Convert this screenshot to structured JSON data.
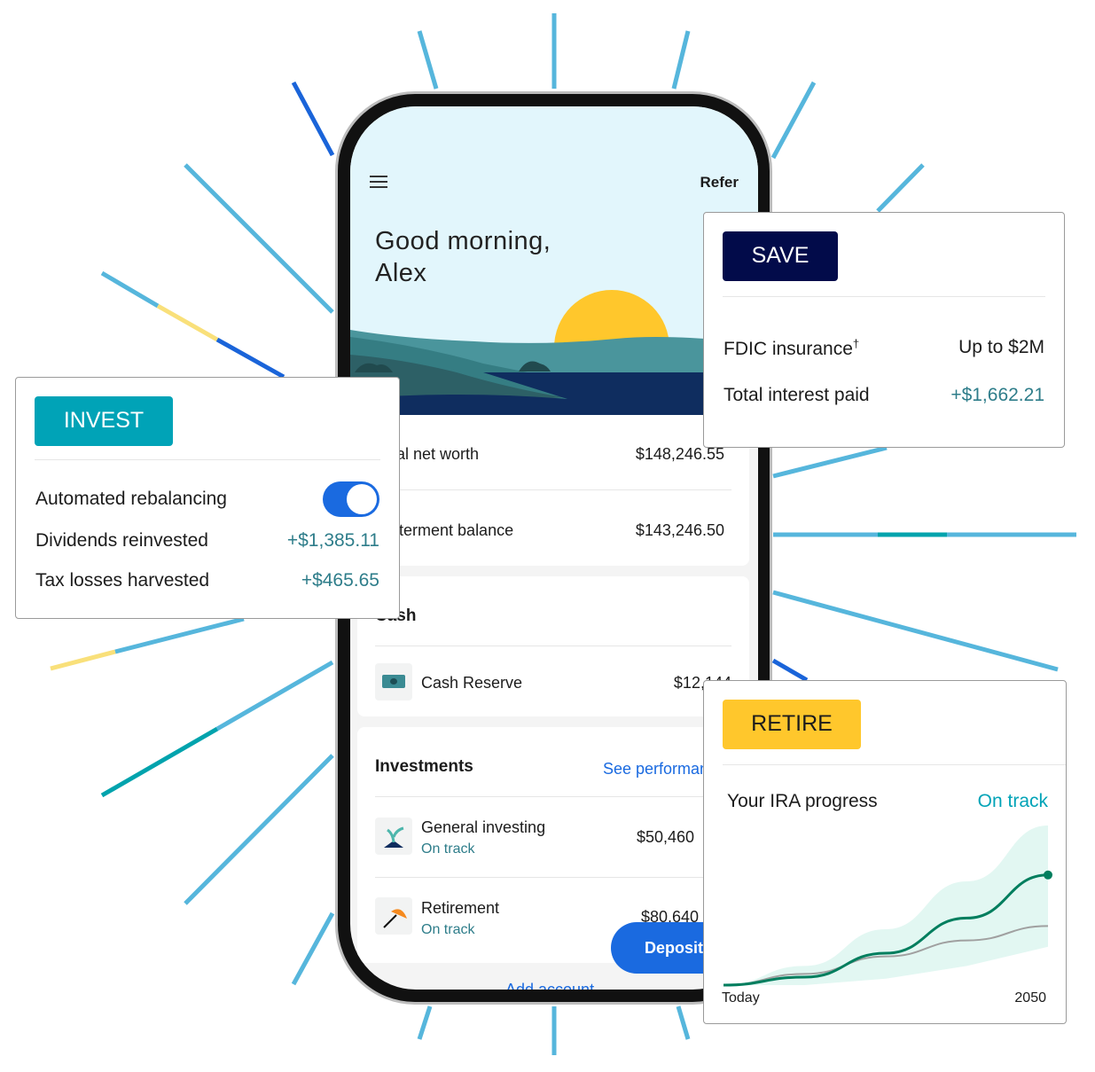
{
  "colors": {
    "ray": "#56b6dc",
    "ray_blue": "#1a64d9",
    "ray_yellow": "#f9e07a",
    "ray_teal": "#00a3ad",
    "invest": "#00a3b7",
    "save": "#020b4a",
    "retire": "#ffc72c",
    "accent_green": "#2e7d8a",
    "link_blue": "#1a6ae0"
  },
  "phone": {
    "header": {
      "menu_icon": "hamburger-icon",
      "refer": "Refer",
      "greeting_line1": "Good morning,",
      "greeting_line2": "Alex"
    },
    "summary": [
      {
        "label": "Total net worth",
        "value": "$148,246.55"
      },
      {
        "label": "Betterment balance",
        "value": "$143,246.50"
      }
    ],
    "cash": {
      "title": "Cash",
      "items": [
        {
          "icon": "cash-icon",
          "name": "Cash Reserve",
          "value": "$12,144"
        }
      ]
    },
    "investments": {
      "title": "Investments",
      "link": "See performance",
      "items": [
        {
          "icon": "seedling-icon",
          "name": "General investing",
          "status": "On track",
          "value": "$50,460"
        },
        {
          "icon": "umbrella-icon",
          "name": "Retirement",
          "status": "On track",
          "value": "$80,640"
        }
      ]
    },
    "deposit": "Deposit",
    "add_account": "Add account"
  },
  "invest_card": {
    "badge": "INVEST",
    "rows": [
      {
        "label": "Automated rebalancing",
        "toggle": true
      },
      {
        "label": "Dividends reinvested",
        "value": "+$1,385.11"
      },
      {
        "label": "Tax losses harvested",
        "value": "+$465.65"
      }
    ]
  },
  "save_card": {
    "badge": "SAVE",
    "rows": [
      {
        "label": "FDIC insurance",
        "sup": "†",
        "value": "Up to $2M"
      },
      {
        "label": "Total interest paid",
        "value": "+$1,662.21"
      }
    ]
  },
  "retire_card": {
    "badge": "RETIRE",
    "title": "Your IRA progress",
    "status": "On track"
  },
  "chart_data": {
    "type": "line",
    "xlabels": [
      "Today",
      "2050"
    ],
    "x": [
      0,
      0.25,
      0.5,
      0.75,
      1
    ],
    "series": [
      {
        "values": [
          0,
          0.05,
          0.2,
          0.42,
          0.69
        ],
        "color": "#007e5e"
      },
      {
        "values": [
          0,
          0.07,
          0.18,
          0.28,
          0.37
        ],
        "color": "#a0a0a0"
      }
    ],
    "band": {
      "upper": [
        0,
        0.12,
        0.35,
        0.65,
        1
      ],
      "lower": [
        0,
        0,
        0.04,
        0.12,
        0.24
      ],
      "color": "#e2f7f2"
    }
  }
}
